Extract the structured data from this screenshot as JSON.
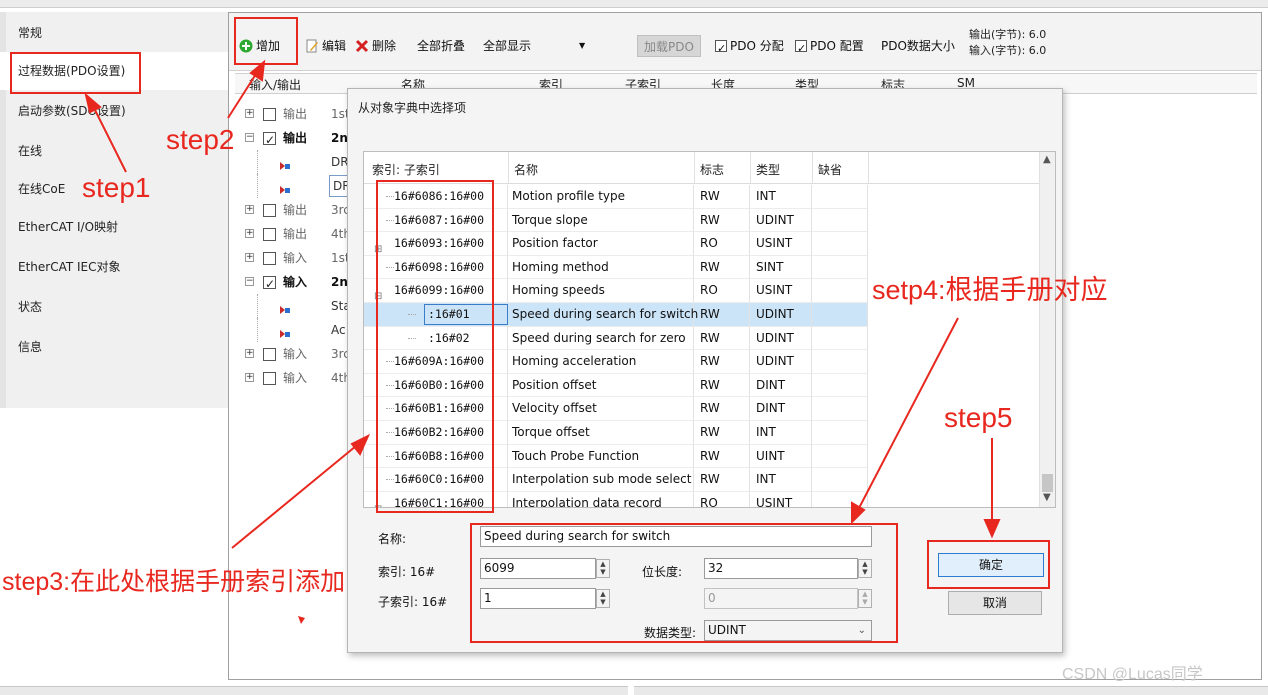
{
  "left_nav": {
    "items": [
      {
        "label": "常规"
      },
      {
        "label": "过程数据(PDO设置)"
      },
      {
        "label": "启动参数(SDO设置)"
      },
      {
        "label": "在线"
      },
      {
        "label": "在线CoE"
      },
      {
        "label": "EtherCAT I/O映射"
      },
      {
        "label": "EtherCAT IEC对象"
      },
      {
        "label": "状态"
      },
      {
        "label": "信息"
      }
    ]
  },
  "toolbar": {
    "add": "增加",
    "edit": "编辑",
    "delete": "删除",
    "collapse_all": "全部折叠",
    "show_all": "全部显示",
    "load_pdo": "加载PDO",
    "pdo_assign": "PDO 分配",
    "pdo_config": "PDO 配置",
    "pdo_size": "PDO数据大小",
    "output_bytes": "输出(字节): 6.0",
    "input_bytes": "输入(字节): 6.0"
  },
  "pdo_table": {
    "headers": [
      "输入/输出",
      "名称",
      "索引",
      "子索引",
      "长度",
      "类型",
      "标志",
      "SM"
    ],
    "rows": [
      {
        "io": "输出",
        "name": "1st",
        "checked": false,
        "expander": "+",
        "bold": false
      },
      {
        "io": "输出",
        "name": "2n",
        "checked": true,
        "expander": "-",
        "bold": true
      },
      {
        "item": "DR"
      },
      {
        "item": "DR"
      },
      {
        "io": "输出",
        "name": "3rc",
        "checked": false,
        "expander": "+",
        "bold": false
      },
      {
        "io": "输出",
        "name": "4th",
        "checked": false,
        "expander": "+",
        "bold": false
      },
      {
        "io": "输入",
        "name": "1st",
        "checked": false,
        "expander": "+",
        "bold": false
      },
      {
        "io": "输入",
        "name": "2n",
        "checked": true,
        "expander": "-",
        "bold": true
      },
      {
        "item": "Sta"
      },
      {
        "item": "Ac"
      },
      {
        "io": "输入",
        "name": "3rc",
        "checked": false,
        "expander": "+",
        "bold": false
      },
      {
        "io": "输入",
        "name": "4th",
        "checked": false,
        "expander": "+",
        "bold": false
      }
    ]
  },
  "dialog": {
    "title": "从对象字典中选择项",
    "list_headers": [
      "索引: 子索引",
      "名称",
      "标志",
      "类型",
      "缺省"
    ],
    "rows": [
      {
        "index": "16#6086:16#00",
        "name": "Motion profile type",
        "flag": "RW",
        "type": "INT"
      },
      {
        "index": "16#6087:16#00",
        "name": "Torque slope",
        "flag": "RW",
        "type": "UDINT"
      },
      {
        "index": "16#6093:16#00",
        "name": "Position factor",
        "flag": "RO",
        "type": "USINT",
        "expander": "+"
      },
      {
        "index": "16#6098:16#00",
        "name": "Homing method",
        "flag": "RW",
        "type": "SINT"
      },
      {
        "index": "16#6099:16#00",
        "name": "Homing speeds",
        "flag": "RO",
        "type": "USINT",
        "expander": "-"
      },
      {
        "index": ":16#01",
        "name": "Speed during search for switch",
        "flag": "RW",
        "type": "UDINT",
        "sub": true,
        "selected": true
      },
      {
        "index": ":16#02",
        "name": "Speed during search for zero",
        "flag": "RW",
        "type": "UDINT",
        "sub": true
      },
      {
        "index": "16#609A:16#00",
        "name": "Homing acceleration",
        "flag": "RW",
        "type": "UDINT"
      },
      {
        "index": "16#60B0:16#00",
        "name": "Position offset",
        "flag": "RW",
        "type": "DINT"
      },
      {
        "index": "16#60B1:16#00",
        "name": "Velocity offset",
        "flag": "RW",
        "type": "DINT"
      },
      {
        "index": "16#60B2:16#00",
        "name": "Torque offset",
        "flag": "RW",
        "type": "INT"
      },
      {
        "index": "16#60B8:16#00",
        "name": "Touch Probe Function",
        "flag": "RW",
        "type": "UINT"
      },
      {
        "index": "16#60C0:16#00",
        "name": "Interpolation sub mode select",
        "flag": "RW",
        "type": "INT"
      },
      {
        "index": "16#60C1:16#00",
        "name": "Interpolation data record",
        "flag": "RO",
        "type": "USINT",
        "expander": "+"
      }
    ],
    "form": {
      "name_label": "名称:",
      "name_value": "Speed during search for switch",
      "index_label": "索引: 16#",
      "index_value": "6099",
      "subindex_label": "子索引: 16#",
      "subindex_value": "1",
      "bitlen_label": "位长度:",
      "bitlen_value": "32",
      "extra_value": "0",
      "datatype_label": "数据类型:",
      "datatype_value": "UDINT"
    },
    "ok": "确定",
    "cancel": "取消"
  },
  "annotations": {
    "step1": "step1",
    "step2": "step2",
    "step3": "step3:在此处根据手册索引添加",
    "step4": "setp4:根据手册对应",
    "step5": "step5",
    "color": "#e8281f"
  },
  "watermark": "CSDN @Lucas同学"
}
